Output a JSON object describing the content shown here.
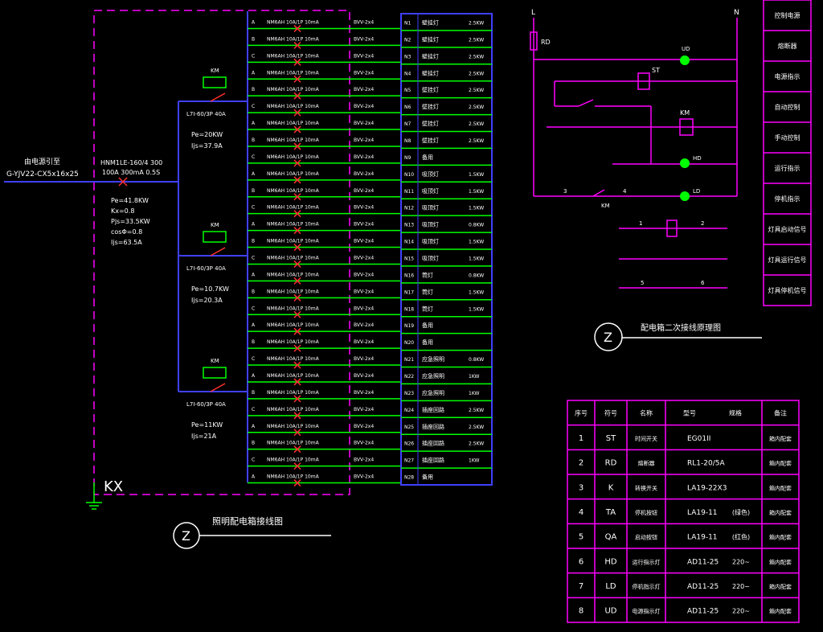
{
  "panel": {
    "incoming_title": "由电源引至",
    "incoming_cable": "G-YJV22-CX5x16x25",
    "main_breaker_1": "HNM1LE-160/4 300",
    "main_breaker_2": "100A 300mA 0.5S",
    "main_params": [
      "Pe=41.8KW",
      "Kx=0.8",
      "Pjs=33.5KW",
      "cosΦ=0.8",
      "Ijs=63.5A"
    ],
    "contactor_label": "KM",
    "branches": [
      {
        "breaker": "L7I-60/3P 40A",
        "pe": "Pe=20KW",
        "ijs": "Ijs=37.9A"
      },
      {
        "breaker": "L7I-60/3P 40A",
        "pe": "Pe=10.7KW",
        "ijs": "Ijs=20.3A"
      },
      {
        "breaker": "L7I-60/3P 40A",
        "pe": "Pe=11KW",
        "ijs": "Ijs=21A"
      }
    ],
    "phases": [
      "A",
      "B",
      "C",
      "A",
      "B",
      "C",
      "A",
      "B",
      "C",
      "A",
      "B",
      "C",
      "A",
      "B",
      "C",
      "A",
      "B",
      "C",
      "A",
      "B",
      "C",
      "A",
      "B",
      "C",
      "A",
      "B",
      "C",
      "A"
    ],
    "feeder_breaker": "NM6AH 10A/1P 10mA",
    "cable": "BVV-2x4",
    "circuits": [
      {
        "id": "N1",
        "name": "壁挂灯",
        "power": "2.5KW"
      },
      {
        "id": "N2",
        "name": "壁挂灯",
        "power": "2.5KW"
      },
      {
        "id": "N3",
        "name": "壁挂灯",
        "power": "2.5KW"
      },
      {
        "id": "N4",
        "name": "壁挂灯",
        "power": "2.5KW"
      },
      {
        "id": "N5",
        "name": "壁挂灯",
        "power": "2.5KW"
      },
      {
        "id": "N6",
        "name": "壁挂灯",
        "power": "2.5KW"
      },
      {
        "id": "N7",
        "name": "壁挂灯",
        "power": "2.5KW"
      },
      {
        "id": "N8",
        "name": "壁挂灯",
        "power": "2.5KW"
      },
      {
        "id": "N9",
        "name": "备用",
        "power": ""
      },
      {
        "id": "N10",
        "name": "吸顶灯",
        "power": "1.5KW"
      },
      {
        "id": "N11",
        "name": "吸顶灯",
        "power": "1.5KW"
      },
      {
        "id": "N12",
        "name": "吸顶灯",
        "power": "1.5KW"
      },
      {
        "id": "N13",
        "name": "吸顶灯",
        "power": "0.8KW"
      },
      {
        "id": "N14",
        "name": "吸顶灯",
        "power": "1.5KW"
      },
      {
        "id": "N15",
        "name": "吸顶灯",
        "power": "1.5KW"
      },
      {
        "id": "N16",
        "name": "筒灯",
        "power": "0.8KW"
      },
      {
        "id": "N17",
        "name": "筒灯",
        "power": "1.5KW"
      },
      {
        "id": "N18",
        "name": "筒灯",
        "power": "1.5KW"
      },
      {
        "id": "N19",
        "name": "备用",
        "power": ""
      },
      {
        "id": "N20",
        "name": "备用",
        "power": ""
      },
      {
        "id": "N21",
        "name": "应急照明",
        "power": "0.8KW"
      },
      {
        "id": "N22",
        "name": "应急照明",
        "power": "1KW"
      },
      {
        "id": "N23",
        "name": "应急照明",
        "power": "1KW"
      },
      {
        "id": "N24",
        "name": "插座回路",
        "power": "2.5KW"
      },
      {
        "id": "N25",
        "name": "插座回路",
        "power": "2.5KW"
      },
      {
        "id": "N26",
        "name": "插座回路",
        "power": "2.5KW"
      },
      {
        "id": "N27",
        "name": "插座回路",
        "power": "1KW"
      },
      {
        "id": "N28",
        "name": "备用",
        "power": ""
      }
    ],
    "enclosure_label": "KX",
    "diagram_symbol": "Z",
    "diagram_title": "照明配电箱接线图"
  },
  "control": {
    "bus_left": "L",
    "bus_right": "N",
    "fuse": "RD",
    "relay": "ST",
    "coil": "KM",
    "lamp_hd": "HD",
    "lamp_ld": "LD",
    "lamp_ud": "UD",
    "node_numbers": [
      "1",
      "2",
      "3",
      "4",
      "5",
      "6"
    ],
    "auxiliary": "KM",
    "side_labels": [
      "控制电源",
      "熔断器",
      "电源指示",
      "自动控制",
      "手动控制",
      "运行指示",
      "停机指示",
      "灯具启动信号",
      "灯具运行信号",
      "灯具停机信号"
    ],
    "diagram_symbol": "Z",
    "diagram_title": "配电箱二次接线原理图"
  },
  "table": {
    "headers": [
      "序号",
      "符号",
      "名称",
      "型号",
      "规格",
      "备注"
    ],
    "rows": [
      {
        "no": "1",
        "sym": "ST",
        "name": "时间开关",
        "model": "EG01II",
        "spec": "",
        "note": "箱内配套"
      },
      {
        "no": "2",
        "sym": "RD",
        "name": "熔断器",
        "model": "RL1-20/5A",
        "spec": "",
        "note": "箱内配套"
      },
      {
        "no": "3",
        "sym": "K",
        "name": "转换开关",
        "model": "LA19-22X3",
        "spec": "",
        "note": "箱内配套"
      },
      {
        "no": "4",
        "sym": "TA",
        "name": "停机按钮",
        "model": "LA19-11",
        "spec": "(绿色)",
        "note": "箱内配套"
      },
      {
        "no": "5",
        "sym": "QA",
        "name": "启动按钮",
        "model": "LA19-11",
        "spec": "(红色)",
        "note": "箱内配套"
      },
      {
        "no": "6",
        "sym": "HD",
        "name": "运行指示灯",
        "model": "AD11-25",
        "spec": "220~",
        "note": "箱内配套"
      },
      {
        "no": "7",
        "sym": "LD",
        "name": "停机指示灯",
        "model": "AD11-25",
        "spec": "220~",
        "note": "箱内配套"
      },
      {
        "no": "8",
        "sym": "UD",
        "name": "电源指示灯",
        "model": "AD11-25",
        "spec": "220~",
        "note": "箱内配套"
      }
    ]
  }
}
